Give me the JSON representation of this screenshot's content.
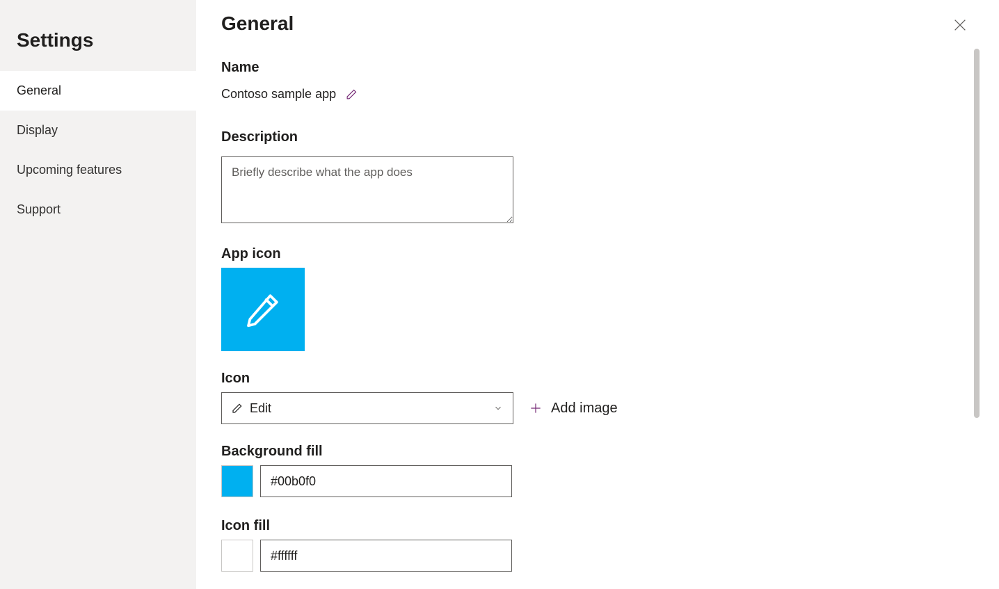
{
  "sidebar": {
    "title": "Settings",
    "items": [
      {
        "label": "General",
        "active": true
      },
      {
        "label": "Display",
        "active": false
      },
      {
        "label": "Upcoming features",
        "active": false
      },
      {
        "label": "Support",
        "active": false
      }
    ]
  },
  "panel": {
    "title": "General",
    "name": {
      "label": "Name",
      "value": "Contoso sample app"
    },
    "description": {
      "label": "Description",
      "placeholder": "Briefly describe what the app does",
      "value": ""
    },
    "app_icon": {
      "label": "App icon",
      "icon_name": "pencil-icon",
      "bg_color": "#00b0f0",
      "fg_color": "#ffffff"
    },
    "icon_select": {
      "label": "Icon",
      "selected": "Edit",
      "selected_icon": "pencil-icon",
      "add_image_label": "Add image"
    },
    "background_fill": {
      "label": "Background fill",
      "value": "#00b0f0",
      "swatch_color": "#00b0f0"
    },
    "icon_fill": {
      "label": "Icon fill",
      "value": "#ffffff",
      "swatch_color": "#ffffff"
    }
  }
}
